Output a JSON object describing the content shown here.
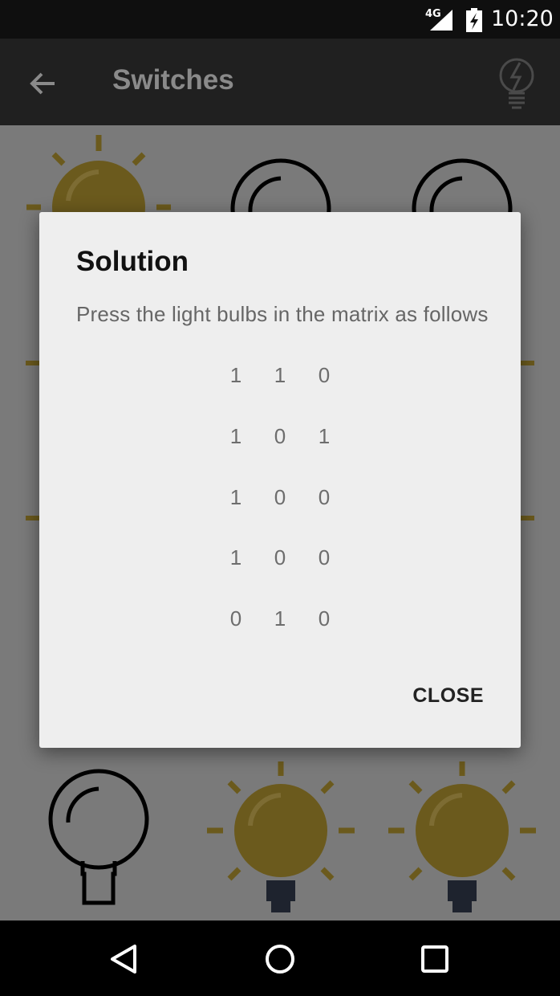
{
  "status_bar": {
    "network": "4G",
    "time": "10:20",
    "icons": [
      "signal-icon",
      "battery-icon"
    ]
  },
  "toolbar": {
    "title": "Switches",
    "back_icon": "arrow-back-icon",
    "hint_icon": "lightbulb-hint-icon"
  },
  "board": {
    "lit_color": "#6b5a1d",
    "unlit_color": "#000000",
    "visible_states": [
      "lit",
      "unlit",
      "unlit",
      "unlit",
      "lit",
      "lit"
    ]
  },
  "dialog": {
    "title": "Solution",
    "message": "Press the light bulbs in the matrix as follows",
    "matrix": [
      [
        "1",
        "1",
        "0"
      ],
      [
        "1",
        "0",
        "1"
      ],
      [
        "1",
        "0",
        "0"
      ],
      [
        "1",
        "0",
        "0"
      ],
      [
        "0",
        "1",
        "0"
      ]
    ],
    "close_label": "CLOSE"
  },
  "nav_bar": {
    "icons": [
      "back-triangle-icon",
      "home-circle-icon",
      "recents-square-icon"
    ]
  }
}
